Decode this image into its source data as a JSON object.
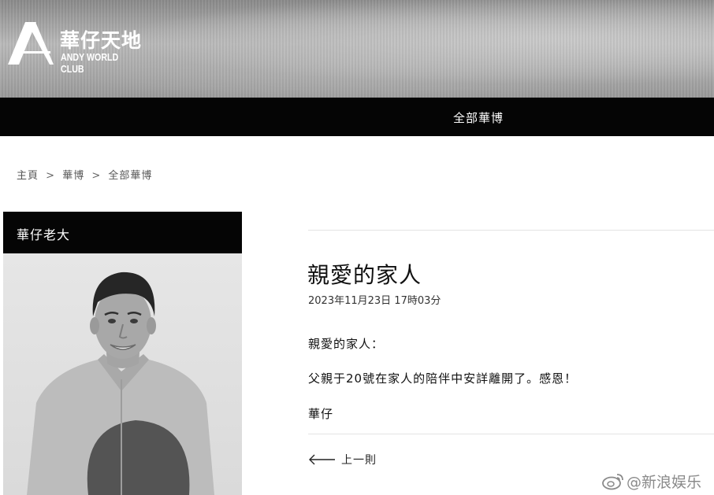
{
  "header": {
    "logo_zh": "華仔天地",
    "logo_en": "ANDY WORLD CLUB"
  },
  "nav": {
    "items": [
      {
        "label": "全部華博"
      }
    ]
  },
  "breadcrumb": {
    "items": [
      "主頁",
      "華博",
      "全部華博"
    ],
    "separator": ">"
  },
  "sidebar": {
    "title": "華仔老大"
  },
  "article": {
    "title": "親愛的家人",
    "date": "2023年11月23日 17時03分",
    "paragraphs": [
      "親愛的家人：",
      "父親于20號在家人的陪伴中安詳離開了。感恩！",
      "華仔"
    ],
    "prev_label": "上一則"
  },
  "watermark": {
    "text": "@新浪娱乐"
  },
  "colors": {
    "nav_bg": "#050505",
    "text": "#111111",
    "watermark": "#8a8a8a"
  }
}
